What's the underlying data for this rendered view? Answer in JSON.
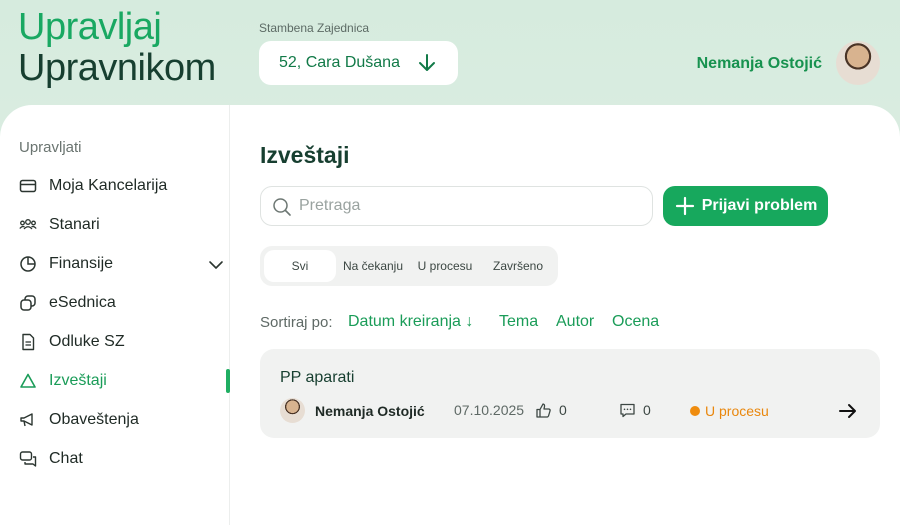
{
  "logo": {
    "line1": "Upravljaj",
    "line2": "Upravnikom"
  },
  "header": {
    "building_label": "Stambena Zajednica",
    "building_value": "52, Cara Dušana",
    "user_name": "Nemanja Ostojić"
  },
  "sidebar": {
    "section": "Upravljati",
    "items": [
      {
        "label": "Moja Kancelarija",
        "icon": "wallet-icon"
      },
      {
        "label": "Stanari",
        "icon": "users-icon"
      },
      {
        "label": "Finansije",
        "icon": "pie-chart-icon"
      },
      {
        "label": "eSednica",
        "icon": "copy-icon"
      },
      {
        "label": "Odluke SZ",
        "icon": "document-icon"
      },
      {
        "label": "Izveštaji",
        "icon": "warning-triangle-icon",
        "active": true
      },
      {
        "label": "Obaveštenja",
        "icon": "megaphone-icon"
      },
      {
        "label": "Chat",
        "icon": "chat-icon"
      }
    ]
  },
  "main": {
    "title": "Izveštaji",
    "search_placeholder": "Pretraga",
    "report_button": "Prijavi problem",
    "tabs": [
      "Svi",
      "Na čekanju",
      "U procesu",
      "Završeno"
    ],
    "sort": {
      "label": "Sortiraj po:",
      "options": [
        "Datum kreiranja ↓",
        "Tema",
        "Autor",
        "Ocena"
      ]
    },
    "reports": [
      {
        "title": "PP aparati",
        "author": "Nemanja Ostojić",
        "date": "07.10.2025",
        "likes": "0",
        "comments": "0",
        "status": "U procesu"
      }
    ]
  },
  "colors": {
    "accent": "#17a85d",
    "dark_green": "#173f30",
    "status_in_progress": "#ef8c0e"
  }
}
